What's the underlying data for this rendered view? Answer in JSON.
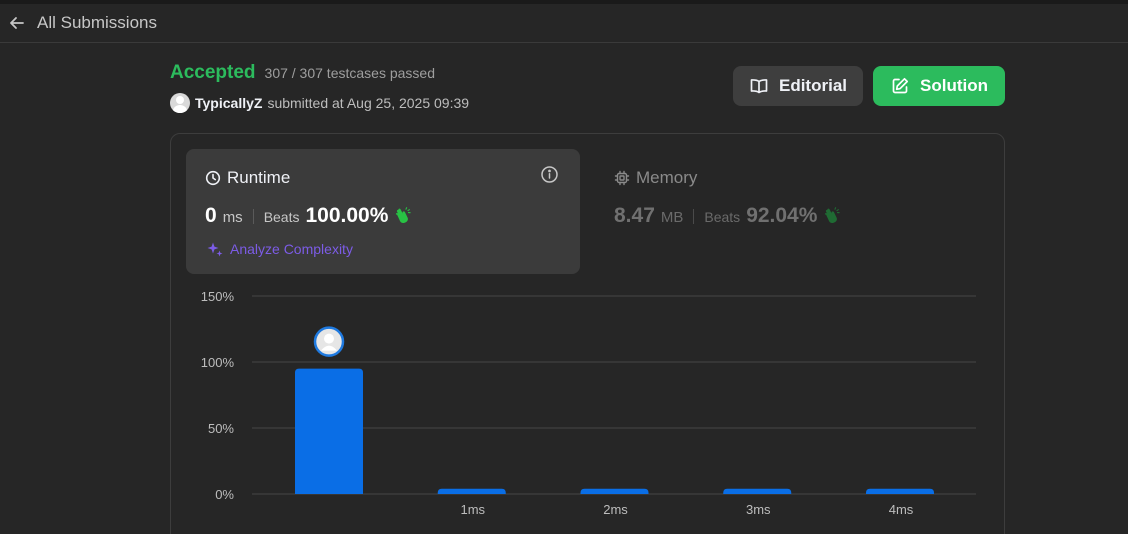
{
  "nav": {
    "back_label": "All Submissions"
  },
  "submission": {
    "status": "Accepted",
    "testcases": "307 / 307 testcases passed",
    "username": "TypicallyZ",
    "submitted_text": "submitted at Aug 25, 2025 09:39"
  },
  "actions": {
    "editorial": "Editorial",
    "solution": "Solution"
  },
  "runtime": {
    "title": "Runtime",
    "value": "0",
    "unit": "ms",
    "beats_label": "Beats",
    "beats_value": "100.00%",
    "analyze": "Analyze Complexity"
  },
  "memory": {
    "title": "Memory",
    "value": "8.47",
    "unit": "MB",
    "beats_label": "Beats",
    "beats_value": "92.04%"
  },
  "colors": {
    "accent_green": "#2cbb5d",
    "bar_blue": "#0a6ee6",
    "analyze_purple": "#7c5ce6"
  },
  "chart_data": {
    "type": "bar",
    "categories": [
      "",
      "1ms",
      "2ms",
      "3ms",
      "4ms"
    ],
    "values": [
      95,
      4,
      4,
      4,
      4
    ],
    "ytick_labels": [
      "0%",
      "50%",
      "100%",
      "150%"
    ],
    "ylim": [
      0,
      150
    ],
    "grid": true,
    "highlight_index": 0
  }
}
